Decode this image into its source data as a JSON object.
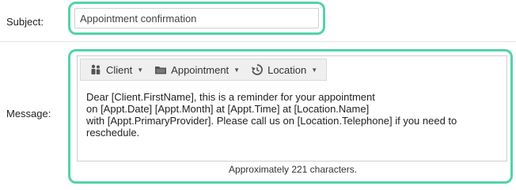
{
  "subject": {
    "label": "Subject:",
    "value": "Appointment confirmation"
  },
  "message": {
    "label": "Message:",
    "toolbar": {
      "client_label": "Client",
      "appointment_label": "Appointment",
      "location_label": "Location"
    },
    "body": "Dear [Client.FirstName], this is a reminder for your appointment\non [Appt.Date] [Appt.Month] at [Appt.Time] at [Location.Name]\nwith [Appt.PrimaryProvider]. Please call us on [Location.Telephone] if you need to\nreschedule.",
    "counter": "Approximately 221 characters."
  },
  "colors": {
    "focus_ring": "#54d3a6",
    "toolbar_bg": "#efefef"
  },
  "icons": {
    "client": "people-icon",
    "appointment": "folder-icon",
    "location": "history-icon",
    "caret": "caret-down-icon"
  }
}
